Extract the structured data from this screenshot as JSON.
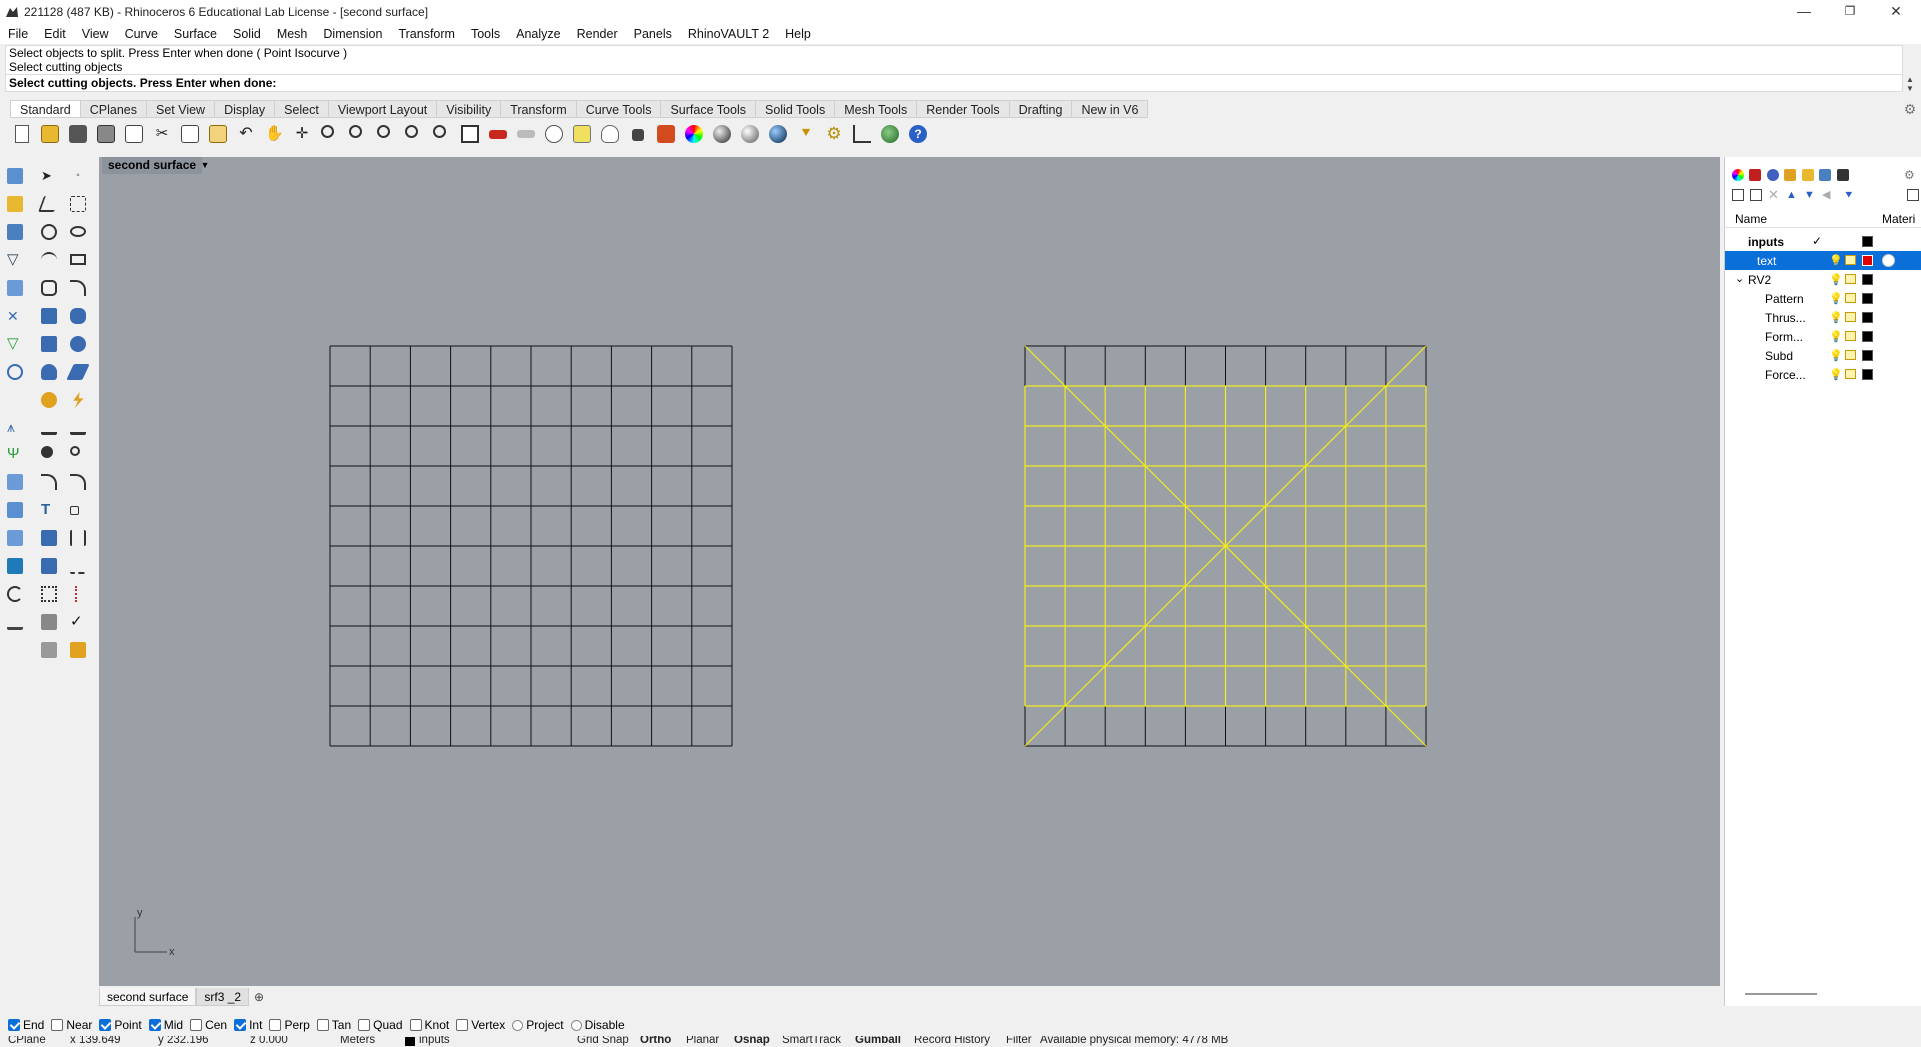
{
  "window": {
    "title": "221128 (487 KB) - Rhinoceros 6 Educational Lab License - [second surface]",
    "minimize": "—",
    "maximize": "❐",
    "close": "✕"
  },
  "menu": [
    "File",
    "Edit",
    "View",
    "Curve",
    "Surface",
    "Solid",
    "Mesh",
    "Dimension",
    "Transform",
    "Tools",
    "Analyze",
    "Render",
    "Panels",
    "RhinoVAULT 2",
    "Help"
  ],
  "command": {
    "history": [
      "Select objects to split. Press Enter when done ( Point  Isocurve )",
      "Select cutting objects"
    ],
    "prompt": "Select cutting objects. Press Enter when done:"
  },
  "toolbar_tabs": [
    "Standard",
    "CPlanes",
    "Set View",
    "Display",
    "Select",
    "Viewport Layout",
    "Visibility",
    "Transform",
    "Curve Tools",
    "Surface Tools",
    "Solid Tools",
    "Mesh Tools",
    "Render Tools",
    "Drafting",
    "New in V6"
  ],
  "viewport": {
    "title": "second surface",
    "axis_y": "y",
    "axis_x": "x",
    "tabs": [
      "second surface",
      "srf3 _2"
    ],
    "add_tab": "⊕"
  },
  "layers": {
    "col_name": "Name",
    "col_material": "Materi",
    "rows": [
      {
        "name": "inputs",
        "current": "✓",
        "color": "#000000"
      },
      {
        "name": "text",
        "color": "#e00000"
      },
      {
        "name": "RV2",
        "color": "#000000",
        "expanded": "⌄"
      },
      {
        "name": "Pattern",
        "color": "#000000"
      },
      {
        "name": "Thrus...",
        "color": "#000000"
      },
      {
        "name": "Form...",
        "color": "#000000"
      },
      {
        "name": "Subd",
        "color": "#000000"
      },
      {
        "name": "Force...",
        "color": "#000000"
      }
    ]
  },
  "osnaps": [
    {
      "label": "End",
      "checked": true
    },
    {
      "label": "Near",
      "checked": false
    },
    {
      "label": "Point",
      "checked": true
    },
    {
      "label": "Mid",
      "checked": true
    },
    {
      "label": "Cen",
      "checked": false
    },
    {
      "label": "Int",
      "checked": true
    },
    {
      "label": "Perp",
      "checked": false
    },
    {
      "label": "Tan",
      "checked": false
    },
    {
      "label": "Quad",
      "checked": false
    },
    {
      "label": "Knot",
      "checked": false
    },
    {
      "label": "Vertex",
      "checked": false
    }
  ],
  "osnap_radios": [
    "Project",
    "Disable"
  ],
  "status": {
    "cplane": "CPlane",
    "x": "x 139.649",
    "y": "y 232.196",
    "z": "z 0.000",
    "units": "Meters",
    "layer": "inputs",
    "grid_snap": "Grid Snap",
    "ortho": "Ortho",
    "planar": "Planar",
    "osnap": "Osnap",
    "smarttrack": "SmartTrack",
    "gumball": "Gumball",
    "record_history": "Record History",
    "filter": "Filter",
    "memory": "Available physical memory: 4778 MB"
  }
}
